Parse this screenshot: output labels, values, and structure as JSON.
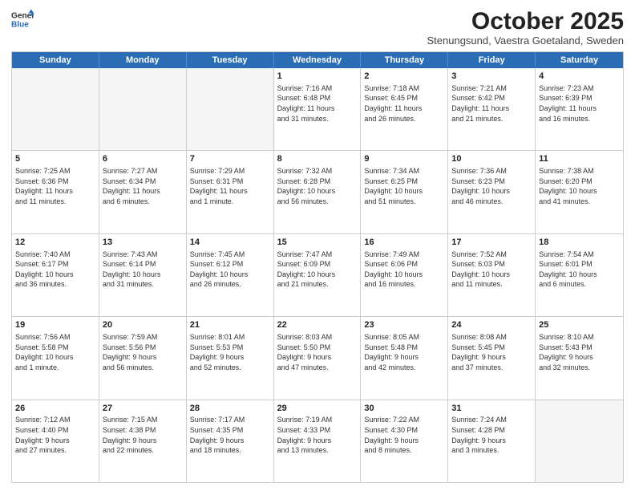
{
  "header": {
    "logo_line1": "General",
    "logo_line2": "Blue",
    "month": "October 2025",
    "location": "Stenungsund, Vaestra Goetaland, Sweden"
  },
  "weekdays": [
    "Sunday",
    "Monday",
    "Tuesday",
    "Wednesday",
    "Thursday",
    "Friday",
    "Saturday"
  ],
  "rows": [
    [
      {
        "day": "",
        "info": "",
        "empty": true
      },
      {
        "day": "",
        "info": "",
        "empty": true
      },
      {
        "day": "",
        "info": "",
        "empty": true
      },
      {
        "day": "1",
        "info": "Sunrise: 7:16 AM\nSunset: 6:48 PM\nDaylight: 11 hours\nand 31 minutes."
      },
      {
        "day": "2",
        "info": "Sunrise: 7:18 AM\nSunset: 6:45 PM\nDaylight: 11 hours\nand 26 minutes."
      },
      {
        "day": "3",
        "info": "Sunrise: 7:21 AM\nSunset: 6:42 PM\nDaylight: 11 hours\nand 21 minutes."
      },
      {
        "day": "4",
        "info": "Sunrise: 7:23 AM\nSunset: 6:39 PM\nDaylight: 11 hours\nand 16 minutes."
      }
    ],
    [
      {
        "day": "5",
        "info": "Sunrise: 7:25 AM\nSunset: 6:36 PM\nDaylight: 11 hours\nand 11 minutes."
      },
      {
        "day": "6",
        "info": "Sunrise: 7:27 AM\nSunset: 6:34 PM\nDaylight: 11 hours\nand 6 minutes."
      },
      {
        "day": "7",
        "info": "Sunrise: 7:29 AM\nSunset: 6:31 PM\nDaylight: 11 hours\nand 1 minute."
      },
      {
        "day": "8",
        "info": "Sunrise: 7:32 AM\nSunset: 6:28 PM\nDaylight: 10 hours\nand 56 minutes."
      },
      {
        "day": "9",
        "info": "Sunrise: 7:34 AM\nSunset: 6:25 PM\nDaylight: 10 hours\nand 51 minutes."
      },
      {
        "day": "10",
        "info": "Sunrise: 7:36 AM\nSunset: 6:23 PM\nDaylight: 10 hours\nand 46 minutes."
      },
      {
        "day": "11",
        "info": "Sunrise: 7:38 AM\nSunset: 6:20 PM\nDaylight: 10 hours\nand 41 minutes."
      }
    ],
    [
      {
        "day": "12",
        "info": "Sunrise: 7:40 AM\nSunset: 6:17 PM\nDaylight: 10 hours\nand 36 minutes."
      },
      {
        "day": "13",
        "info": "Sunrise: 7:43 AM\nSunset: 6:14 PM\nDaylight: 10 hours\nand 31 minutes."
      },
      {
        "day": "14",
        "info": "Sunrise: 7:45 AM\nSunset: 6:12 PM\nDaylight: 10 hours\nand 26 minutes."
      },
      {
        "day": "15",
        "info": "Sunrise: 7:47 AM\nSunset: 6:09 PM\nDaylight: 10 hours\nand 21 minutes."
      },
      {
        "day": "16",
        "info": "Sunrise: 7:49 AM\nSunset: 6:06 PM\nDaylight: 10 hours\nand 16 minutes."
      },
      {
        "day": "17",
        "info": "Sunrise: 7:52 AM\nSunset: 6:03 PM\nDaylight: 10 hours\nand 11 minutes."
      },
      {
        "day": "18",
        "info": "Sunrise: 7:54 AM\nSunset: 6:01 PM\nDaylight: 10 hours\nand 6 minutes."
      }
    ],
    [
      {
        "day": "19",
        "info": "Sunrise: 7:56 AM\nSunset: 5:58 PM\nDaylight: 10 hours\nand 1 minute."
      },
      {
        "day": "20",
        "info": "Sunrise: 7:59 AM\nSunset: 5:56 PM\nDaylight: 9 hours\nand 56 minutes."
      },
      {
        "day": "21",
        "info": "Sunrise: 8:01 AM\nSunset: 5:53 PM\nDaylight: 9 hours\nand 52 minutes."
      },
      {
        "day": "22",
        "info": "Sunrise: 8:03 AM\nSunset: 5:50 PM\nDaylight: 9 hours\nand 47 minutes."
      },
      {
        "day": "23",
        "info": "Sunrise: 8:05 AM\nSunset: 5:48 PM\nDaylight: 9 hours\nand 42 minutes."
      },
      {
        "day": "24",
        "info": "Sunrise: 8:08 AM\nSunset: 5:45 PM\nDaylight: 9 hours\nand 37 minutes."
      },
      {
        "day": "25",
        "info": "Sunrise: 8:10 AM\nSunset: 5:43 PM\nDaylight: 9 hours\nand 32 minutes."
      }
    ],
    [
      {
        "day": "26",
        "info": "Sunrise: 7:12 AM\nSunset: 4:40 PM\nDaylight: 9 hours\nand 27 minutes."
      },
      {
        "day": "27",
        "info": "Sunrise: 7:15 AM\nSunset: 4:38 PM\nDaylight: 9 hours\nand 22 minutes."
      },
      {
        "day": "28",
        "info": "Sunrise: 7:17 AM\nSunset: 4:35 PM\nDaylight: 9 hours\nand 18 minutes."
      },
      {
        "day": "29",
        "info": "Sunrise: 7:19 AM\nSunset: 4:33 PM\nDaylight: 9 hours\nand 13 minutes."
      },
      {
        "day": "30",
        "info": "Sunrise: 7:22 AM\nSunset: 4:30 PM\nDaylight: 9 hours\nand 8 minutes."
      },
      {
        "day": "31",
        "info": "Sunrise: 7:24 AM\nSunset: 4:28 PM\nDaylight: 9 hours\nand 3 minutes."
      },
      {
        "day": "",
        "info": "",
        "empty": true,
        "shaded": true
      }
    ]
  ]
}
